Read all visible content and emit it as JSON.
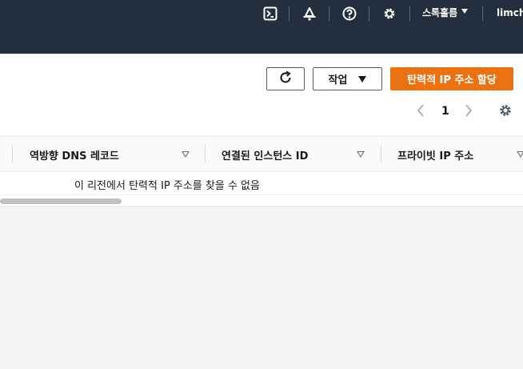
{
  "topnav": {
    "region_label": "스톡홀름",
    "user_label": "limcha"
  },
  "toolbar": {
    "refresh_label": "",
    "actions_label": "작업",
    "allocate_label": "탄력적 IP 주소 할당"
  },
  "pagination": {
    "current_page": "1"
  },
  "table": {
    "columns": [
      {
        "label": "역방향 DNS 레코드"
      },
      {
        "label": "연결된 인스턴스 ID"
      },
      {
        "label": "프라이빗 IP 주소"
      }
    ],
    "empty_message": "이 리전에서 탄력적 IP 주소를 찾을 수 없음"
  },
  "colors": {
    "nav_bg": "#232f3e",
    "primary": "#ec7211",
    "panel_bg": "#ffffff",
    "page_bg": "#f2f3f3"
  },
  "icons": {
    "nav": [
      "cloudshell-icon",
      "notifications-icon",
      "help-icon",
      "settings-icon"
    ],
    "toolbar": [
      "refresh-icon",
      "caret-down-icon"
    ],
    "pagination": [
      "chevron-left-icon",
      "chevron-right-icon",
      "preferences-gear-icon"
    ],
    "table": [
      "sort-icon"
    ]
  }
}
